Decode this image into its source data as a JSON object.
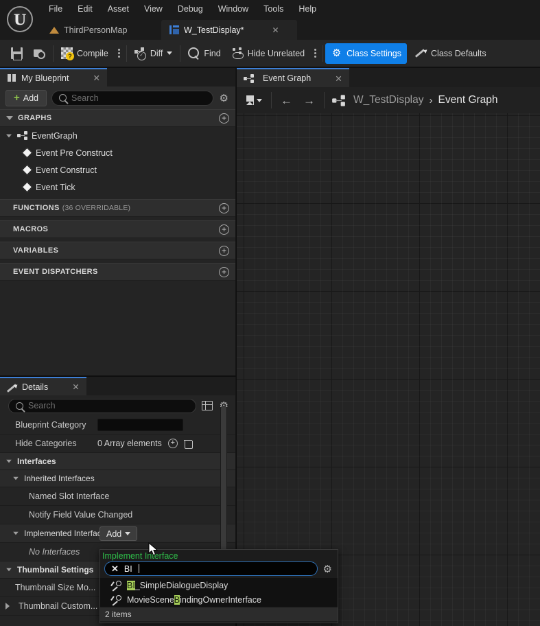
{
  "app": {
    "logo_glyph": "U",
    "menu": [
      "File",
      "Edit",
      "Asset",
      "View",
      "Debug",
      "Window",
      "Tools",
      "Help"
    ],
    "asset_tabs": [
      {
        "label": "ThirdPersonMap",
        "icon": "map-icon",
        "active": false,
        "close": "✕"
      },
      {
        "label": "W_TestDisplay*",
        "icon": "widget-blueprint-icon",
        "active": true,
        "close": "✕"
      }
    ]
  },
  "toolbar": {
    "save_label": "",
    "browse_label": "",
    "compile_label": "Compile",
    "diff_label": "Diff",
    "find_label": "Find",
    "hide_unrelated_label": "Hide Unrelated",
    "class_settings_label": "Class Settings",
    "class_defaults_label": "Class Defaults",
    "accent_color": "#0f7fe8"
  },
  "my_blueprint": {
    "tab_label": "My Blueprint",
    "tab_close": "✕",
    "add_label": "Add",
    "search_placeholder": "Search",
    "search_value": "",
    "sections": [
      {
        "label": "GRAPHS",
        "sub": ""
      },
      {
        "label": "FUNCTIONS",
        "sub": "(36 OVERRIDABLE)"
      },
      {
        "label": "MACROS",
        "sub": ""
      },
      {
        "label": "VARIABLES",
        "sub": ""
      },
      {
        "label": "EVENT DISPATCHERS",
        "sub": ""
      }
    ],
    "graph_root": "EventGraph",
    "graph_events": [
      "Event Pre Construct",
      "Event Construct",
      "Event Tick"
    ]
  },
  "details": {
    "tab_label": "Details",
    "tab_close": "✕",
    "search_placeholder": "Search",
    "search_value": "",
    "rows": [
      {
        "name": "Blueprint Category",
        "value": ""
      },
      {
        "name": "Hide Categories",
        "value": "0 Array elements"
      }
    ],
    "interfaces_header": "Interfaces",
    "inherited_header": "Inherited Interfaces",
    "inherited_items": [
      "Named Slot Interface",
      "Notify Field Value Changed"
    ],
    "implemented_header": "Implemented Interfac",
    "implemented_add_label": "Add",
    "no_interfaces": "No Interfaces",
    "thumbnail_header": "Thumbnail Settings",
    "thumbnail_rows": [
      "Thumbnail Size Mo...",
      "Thumbnail Custom..."
    ]
  },
  "graph": {
    "tab_label": "Event Graph",
    "tab_close": "✕",
    "breadcrumb_root": "W_TestDisplay",
    "breadcrumb_sep": "›",
    "breadcrumb_current": "Event Graph",
    "back_arrow": "←",
    "forward_arrow": "→"
  },
  "implement_interface_popup": {
    "title": "Implement Interface",
    "clear_glyph": "✕",
    "query": "BI",
    "items": [
      {
        "highlight": "BI",
        "rest": "_SimpleDialogueDisplay",
        "prefix": ""
      },
      {
        "highlight": "B",
        "rest": "indingOwnerInterface",
        "prefix": "MovieScene"
      }
    ],
    "footer": "2 items"
  }
}
